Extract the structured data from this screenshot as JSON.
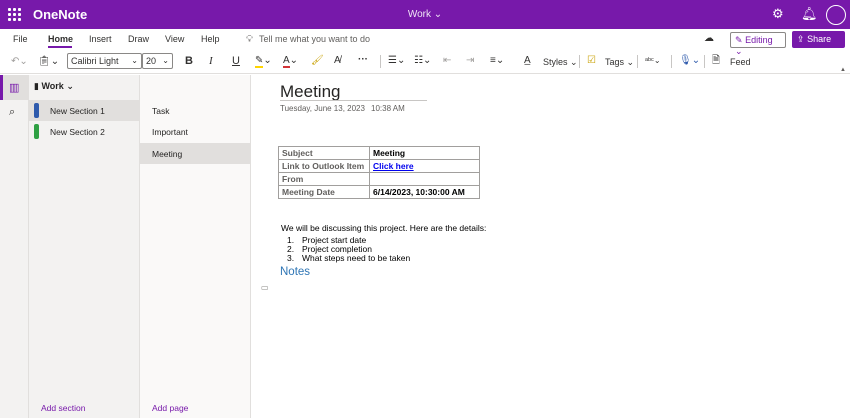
{
  "titlebar": {
    "app_name": "OneNote",
    "document_title": "Work",
    "document_title_chevron": "⌄",
    "icons": [
      "waffle-icon",
      "gear-icon",
      "bell-icon",
      "avatar"
    ],
    "color": "#7719aa"
  },
  "menu": {
    "items": [
      "File",
      "Home",
      "Insert",
      "Draw",
      "View",
      "Help"
    ],
    "active": "Home",
    "tell_me": "Tell me what you want to do",
    "editing_label": "Editing",
    "share_label": "Share"
  },
  "toolbar": {
    "font_name": "Calibri Light",
    "font_size": "20",
    "bold": "B",
    "italic": "I",
    "underline": "U",
    "styles_label": "Styles",
    "tags_label": "Tags",
    "feed_label": "Feed",
    "more": "···"
  },
  "notebook": {
    "name": "Work"
  },
  "sections": [
    {
      "label": "New Section 1",
      "color": "#2e5aac",
      "selected": true
    },
    {
      "label": "New Section 2",
      "color": "#2ea043",
      "selected": false
    }
  ],
  "add_section_label": "Add section",
  "pages": [
    {
      "label": "Task",
      "selected": false
    },
    {
      "label": "Important",
      "selected": false
    },
    {
      "label": "Meeting",
      "selected": true
    }
  ],
  "add_page_label": "Add page",
  "page": {
    "title": "Meeting",
    "date": "Tuesday, June 13, 2023",
    "time": "10:38 AM",
    "table": [
      {
        "key": "Subject",
        "value": "Meeting",
        "link": false
      },
      {
        "key": "Link to Outlook Item",
        "value": "Click here",
        "link": true
      },
      {
        "key": "From",
        "value": "",
        "link": false
      },
      {
        "key": "Meeting Date",
        "value": "6/14/2023, 10:30:00 AM",
        "link": false
      }
    ],
    "intro": "We will be discussing this project. Here are the details:",
    "details": [
      {
        "num": "1.",
        "text": "Project start date"
      },
      {
        "num": "2.",
        "text": "Project completion"
      },
      {
        "num": "3.",
        "text": "What steps need to be taken"
      }
    ],
    "notes_heading": "Notes"
  }
}
